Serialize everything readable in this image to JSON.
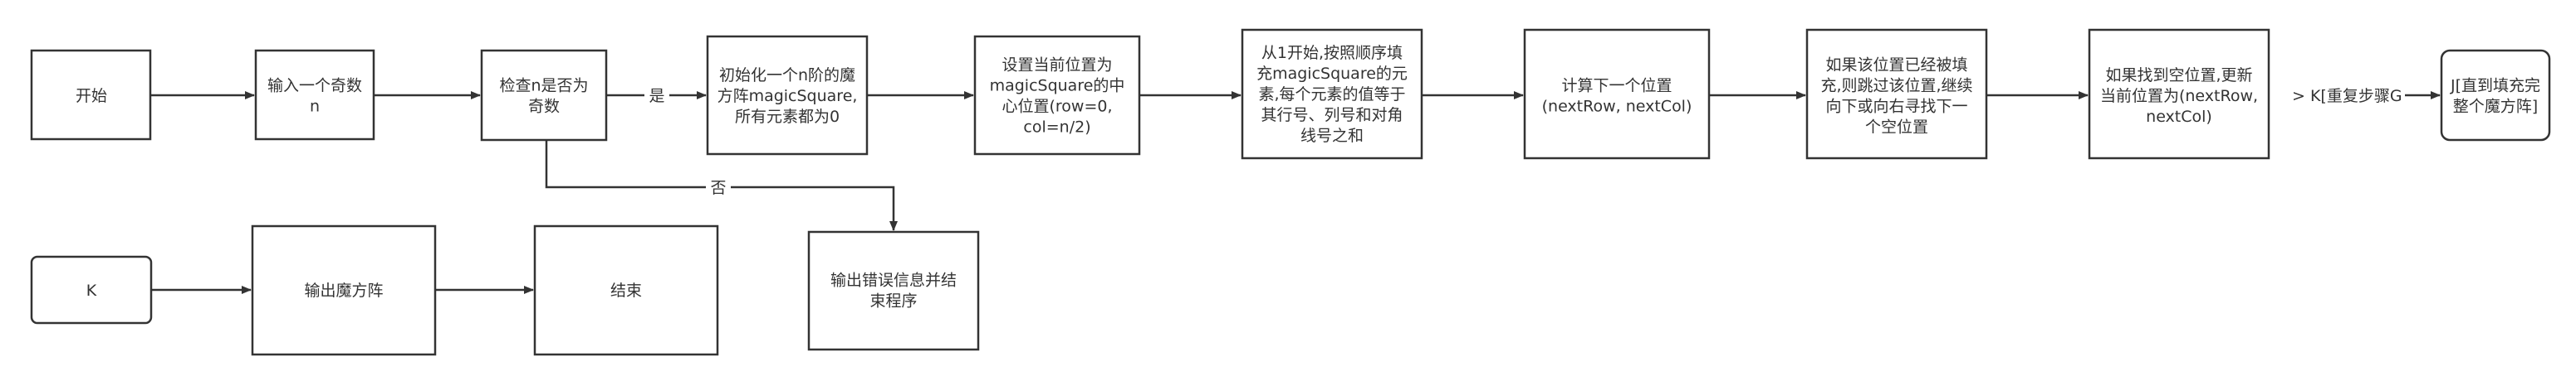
{
  "colors": {
    "stroke": "#333333",
    "fill": "#ffffff",
    "text": "#333333"
  },
  "nodes": {
    "start": {
      "lines": [
        "开始"
      ]
    },
    "input_n": {
      "lines": [
        "输入一个奇数",
        "n"
      ]
    },
    "check_odd": {
      "lines": [
        "检查n是否为",
        "奇数"
      ]
    },
    "init_square": {
      "lines": [
        "初始化一个n阶的魔",
        "方阵magicSquare,",
        "所有元素都为0"
      ]
    },
    "set_center": {
      "lines": [
        "设置当前位置为",
        "magicSquare的中",
        "心位置(row=0,",
        "col=n/2)"
      ]
    },
    "fill_elements": {
      "lines": [
        "从1开始,按照顺序填",
        "充magicSquare的元",
        "素,每个元素的值等于",
        "其行号、列号和对角",
        "线号之和"
      ]
    },
    "calc_next": {
      "lines": [
        "计算下一个位置",
        "(nextRow, nextCol)"
      ]
    },
    "skip_filled": {
      "lines": [
        "如果该位置已经被填",
        "充,则跳过该位置,继续",
        "向下或向右寻找下一",
        "个空位置"
      ]
    },
    "update_pos": {
      "lines": [
        "如果找到空位置,更新",
        "当前位置为(nextRow,",
        "nextCol)"
      ]
    },
    "until_done": {
      "lines": [
        "J[直到填充完",
        "整个魔方阵]"
      ]
    },
    "k_node": {
      "lines": [
        "K"
      ]
    },
    "output_square": {
      "lines": [
        "输出魔方阵"
      ]
    },
    "end": {
      "lines": [
        "结束"
      ]
    },
    "error_exit": {
      "lines": [
        "输出错误信息并结",
        "束程序"
      ]
    }
  },
  "edge_labels": {
    "yes": "是",
    "no": "否",
    "repeat": "> K[重复步骤G"
  }
}
